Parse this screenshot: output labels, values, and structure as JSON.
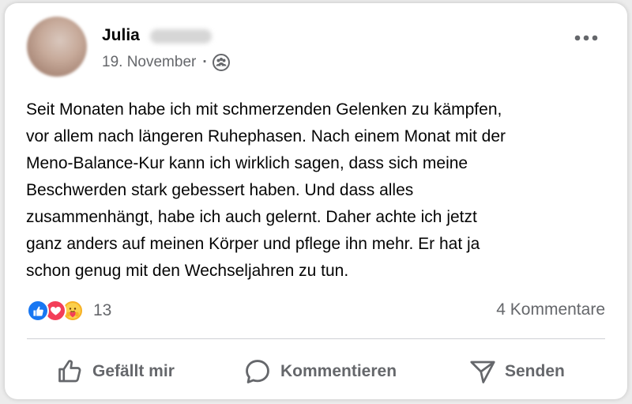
{
  "post": {
    "author_name": "Julia",
    "date": "19. November",
    "separator": "·",
    "audience_icon": "friends-icon",
    "more_icon": "more-horizontal-icon",
    "text_lines": [
      "Seit Monaten habe ich mit schmerzenden Gelenken zu kämpfen,",
      "vor allem nach längeren Ruhephasen. Nach einem Monat mit der",
      "Meno-Balance-Kur kann ich wirklich sagen, dass sich meine",
      "Beschwerden stark gebessert haben. Und dass alles",
      "zusammenhängt, habe ich auch gelernt. Daher achte ich jetzt",
      "ganz anders auf meinen Körper und pflege ihn mehr. Er hat ja",
      "schon genug mit den Wechseljahren zu tun."
    ]
  },
  "reactions": {
    "icons": [
      "like-reaction-icon",
      "love-reaction-icon",
      "care-reaction-icon"
    ],
    "count": "13"
  },
  "comments_count": "4 Kommentare",
  "actions": {
    "like": "Gefällt mir",
    "comment": "Kommentieren",
    "send": "Senden"
  },
  "colors": {
    "like": "#1877f2",
    "love": "#f33e58",
    "care": "#f7b125",
    "secondary_text": "#65676b",
    "primary_text": "#050505"
  }
}
